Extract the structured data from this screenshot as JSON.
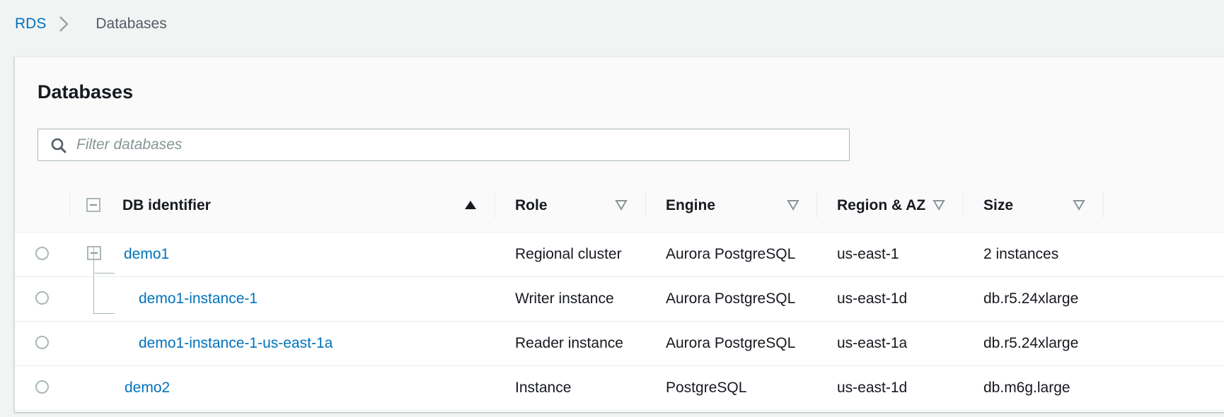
{
  "breadcrumb": {
    "root": "RDS",
    "current": "Databases"
  },
  "panel": {
    "title": "Databases",
    "search_placeholder": "Filter databases"
  },
  "columns": {
    "identifier": "DB identifier",
    "role": "Role",
    "engine": "Engine",
    "region": "Region & AZ",
    "size": "Size"
  },
  "rows": [
    {
      "identifier": "demo1",
      "role": "Regional cluster",
      "engine": "Aurora PostgreSQL",
      "region": "us-east-1",
      "size": "2 instances"
    },
    {
      "identifier": "demo1-instance-1",
      "role": "Writer instance",
      "engine": "Aurora PostgreSQL",
      "region": "us-east-1d",
      "size": "db.r5.24xlarge"
    },
    {
      "identifier": "demo1-instance-1-us-east-1a",
      "role": "Reader instance",
      "engine": "Aurora PostgreSQL",
      "region": "us-east-1a",
      "size": "db.r5.24xlarge"
    },
    {
      "identifier": "demo2",
      "role": "Instance",
      "engine": "PostgreSQL",
      "region": "us-east-1d",
      "size": "db.m6g.large"
    }
  ],
  "colors": {
    "link": "#0073bb",
    "border": "#aab7b8",
    "background": "#f2f3f3"
  },
  "icons": {
    "breadcrumb_separator": "chevron-right-icon",
    "search": "search-icon",
    "sort_ascending": "sort-ascending-icon",
    "sort_descending": "sort-descending-icon",
    "collapse": "collapse-icon",
    "radio": "radio-button"
  }
}
